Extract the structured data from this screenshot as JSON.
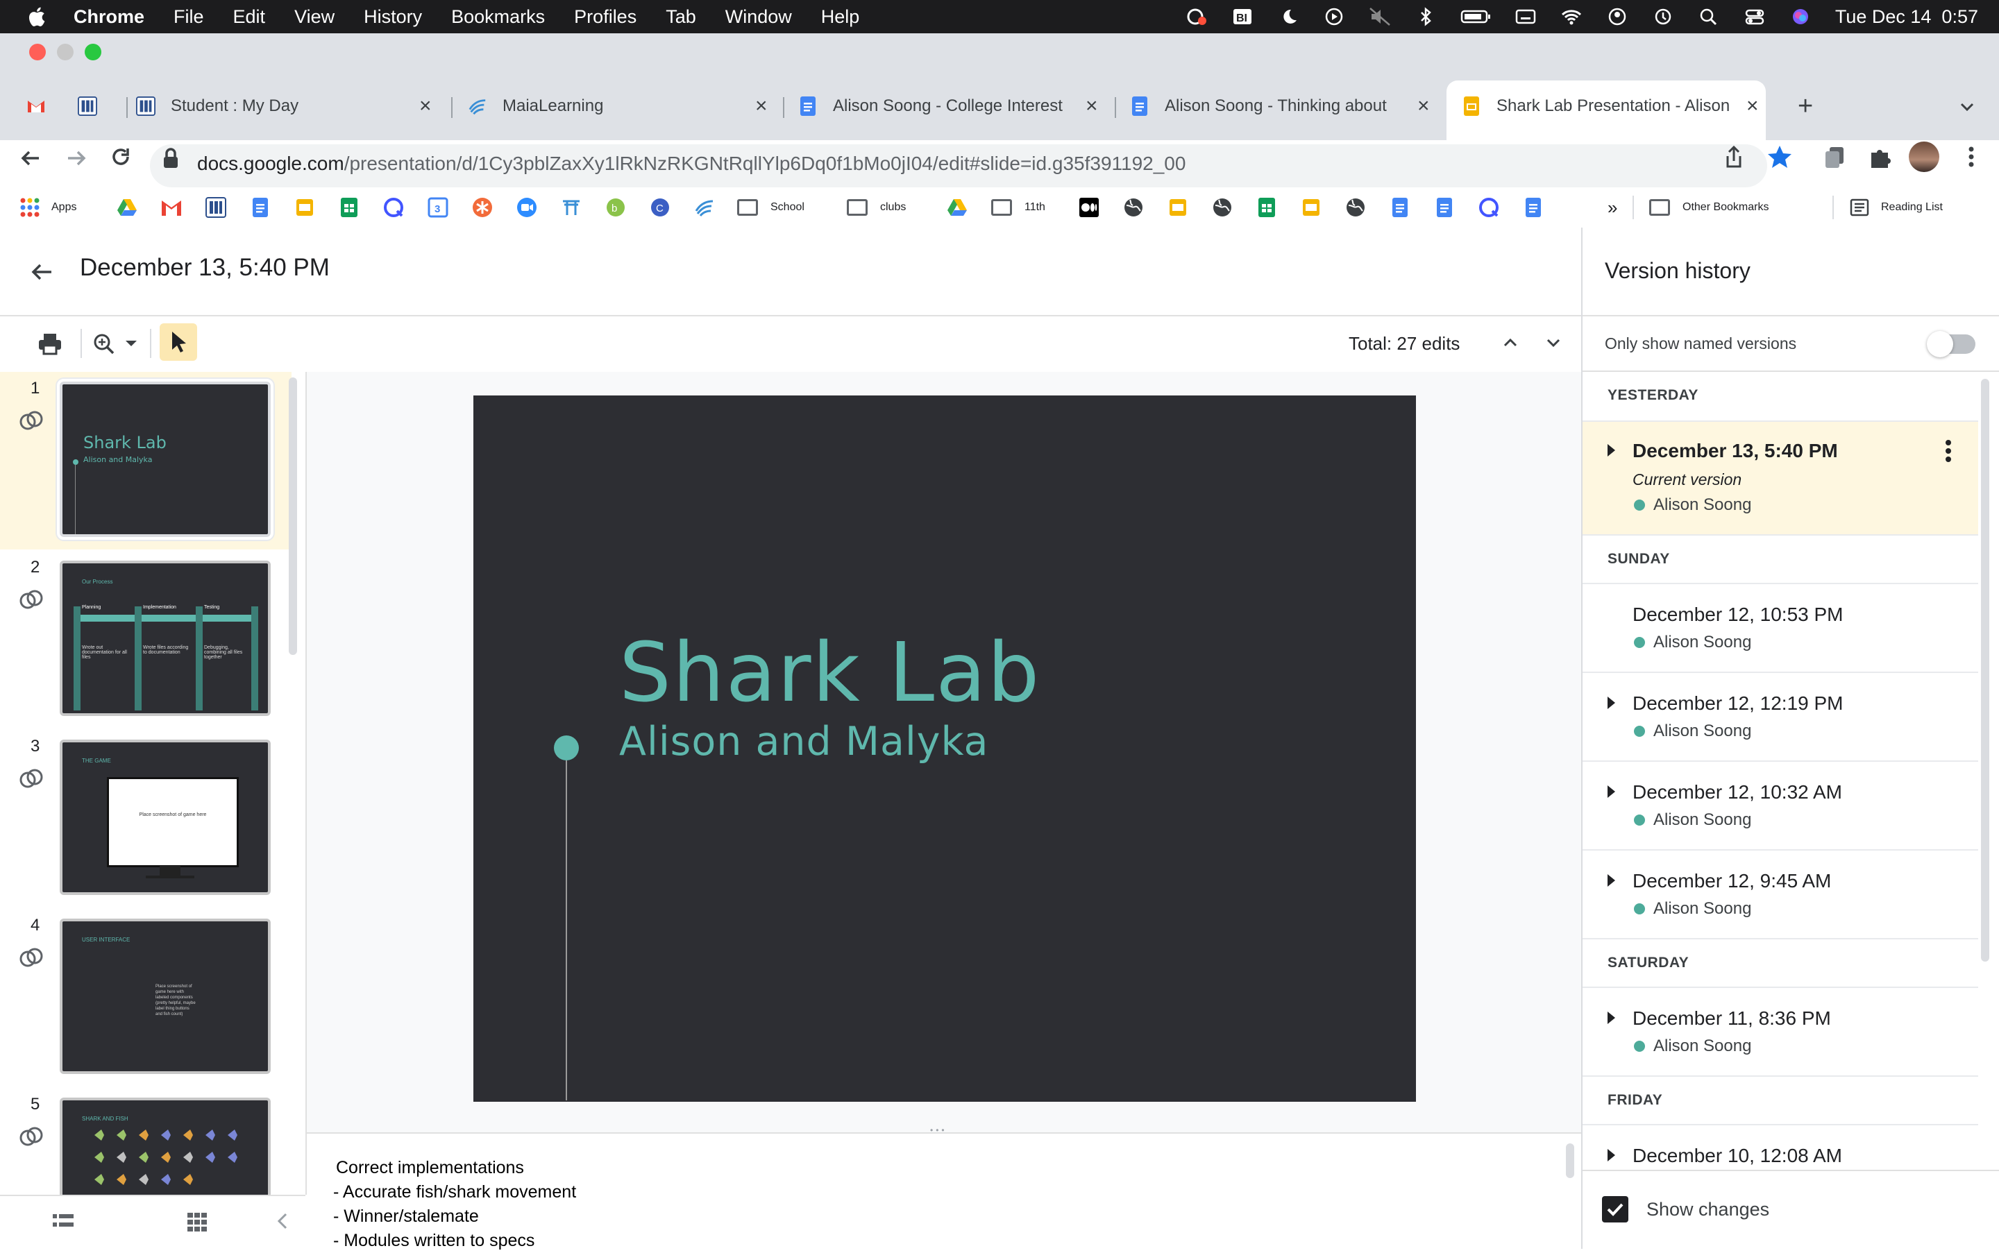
{
  "menubar": {
    "app": "Chrome",
    "items": [
      "File",
      "Edit",
      "View",
      "History",
      "Bookmarks",
      "Profiles",
      "Tab",
      "Window",
      "Help"
    ],
    "clock": "Tue Dec 14  0:57"
  },
  "tabs": [
    {
      "title": "Student : My Day"
    },
    {
      "title": "MaiaLearning"
    },
    {
      "title": "Alison Soong - College Interest"
    },
    {
      "title": "Alison Soong - Thinking about"
    },
    {
      "title": "Shark Lab Presentation - Alison"
    }
  ],
  "address": {
    "host": "docs.google.com",
    "path": "/presentation/d/1Cy3pblZaxXy1lRkNzRKGNtRqllYlp6Dq0f1bMo0jI04/edit#slide=id.g35f391192_00"
  },
  "bookmarks": {
    "apps": "Apps",
    "school": "School",
    "clubs": "clubs",
    "eleventh": "11th",
    "more": "»",
    "other": "Other Bookmarks",
    "reading": "Reading List"
  },
  "doc": {
    "version_title": "December 13, 5:40 PM",
    "total_edits": "Total: 27 edits"
  },
  "slides": [
    {
      "num": "1",
      "title": "Shark Lab",
      "subtitle": "Alison and Malyka"
    },
    {
      "num": "2",
      "heading": "Our Process",
      "cols": [
        "Planning",
        "Implementation",
        "Testing"
      ],
      "texts": [
        "Wrote out documentation for all files",
        "Wrote files according to documentation",
        "Debugging, combining all files together"
      ]
    },
    {
      "num": "3",
      "heading": "THE GAME",
      "box": "Place screenshot of game here"
    },
    {
      "num": "4",
      "heading": "USER INTERFACE",
      "body": "Place screenshot of game here with labeled components (pretty helpful, maybe label thing buttons and fish count)"
    },
    {
      "num": "5",
      "heading": "SHARK AND FISH"
    }
  ],
  "main_slide": {
    "title": "Shark Lab",
    "subtitle": "Alison and Malyka"
  },
  "notes": {
    "lines": [
      "Correct implementations",
      "- Accurate fish/shark movement",
      "- Winner/stalemate",
      "- Modules written to specs"
    ]
  },
  "version_history": {
    "title": "Version history",
    "toggle_label": "Only show named versions",
    "sections": [
      {
        "label": "YESTERDAY"
      },
      {
        "label": "SUNDAY"
      },
      {
        "label": "SATURDAY"
      },
      {
        "label": "FRIDAY"
      }
    ],
    "entries": [
      {
        "title": "December 13, 5:40 PM",
        "note": "Current version",
        "user": "Alison Soong"
      },
      {
        "title": "December 12, 10:53 PM",
        "user": "Alison Soong"
      },
      {
        "title": "December 12, 12:19 PM",
        "user": "Alison Soong"
      },
      {
        "title": "December 12, 10:32 AM",
        "user": "Alison Soong"
      },
      {
        "title": "December 12, 9:45 AM",
        "user": "Alison Soong"
      },
      {
        "title": "December 11, 8:36 PM",
        "user": "Alison Soong"
      },
      {
        "title": "December 10, 12:08 AM",
        "user": ""
      }
    ],
    "show_changes": "Show changes"
  },
  "colors": {
    "accent_teal": "#5fb8ad",
    "slide_bg": "#2d2e33",
    "selected_entry_bg": "#fef7e0",
    "user_dot": "#4dab9a"
  }
}
